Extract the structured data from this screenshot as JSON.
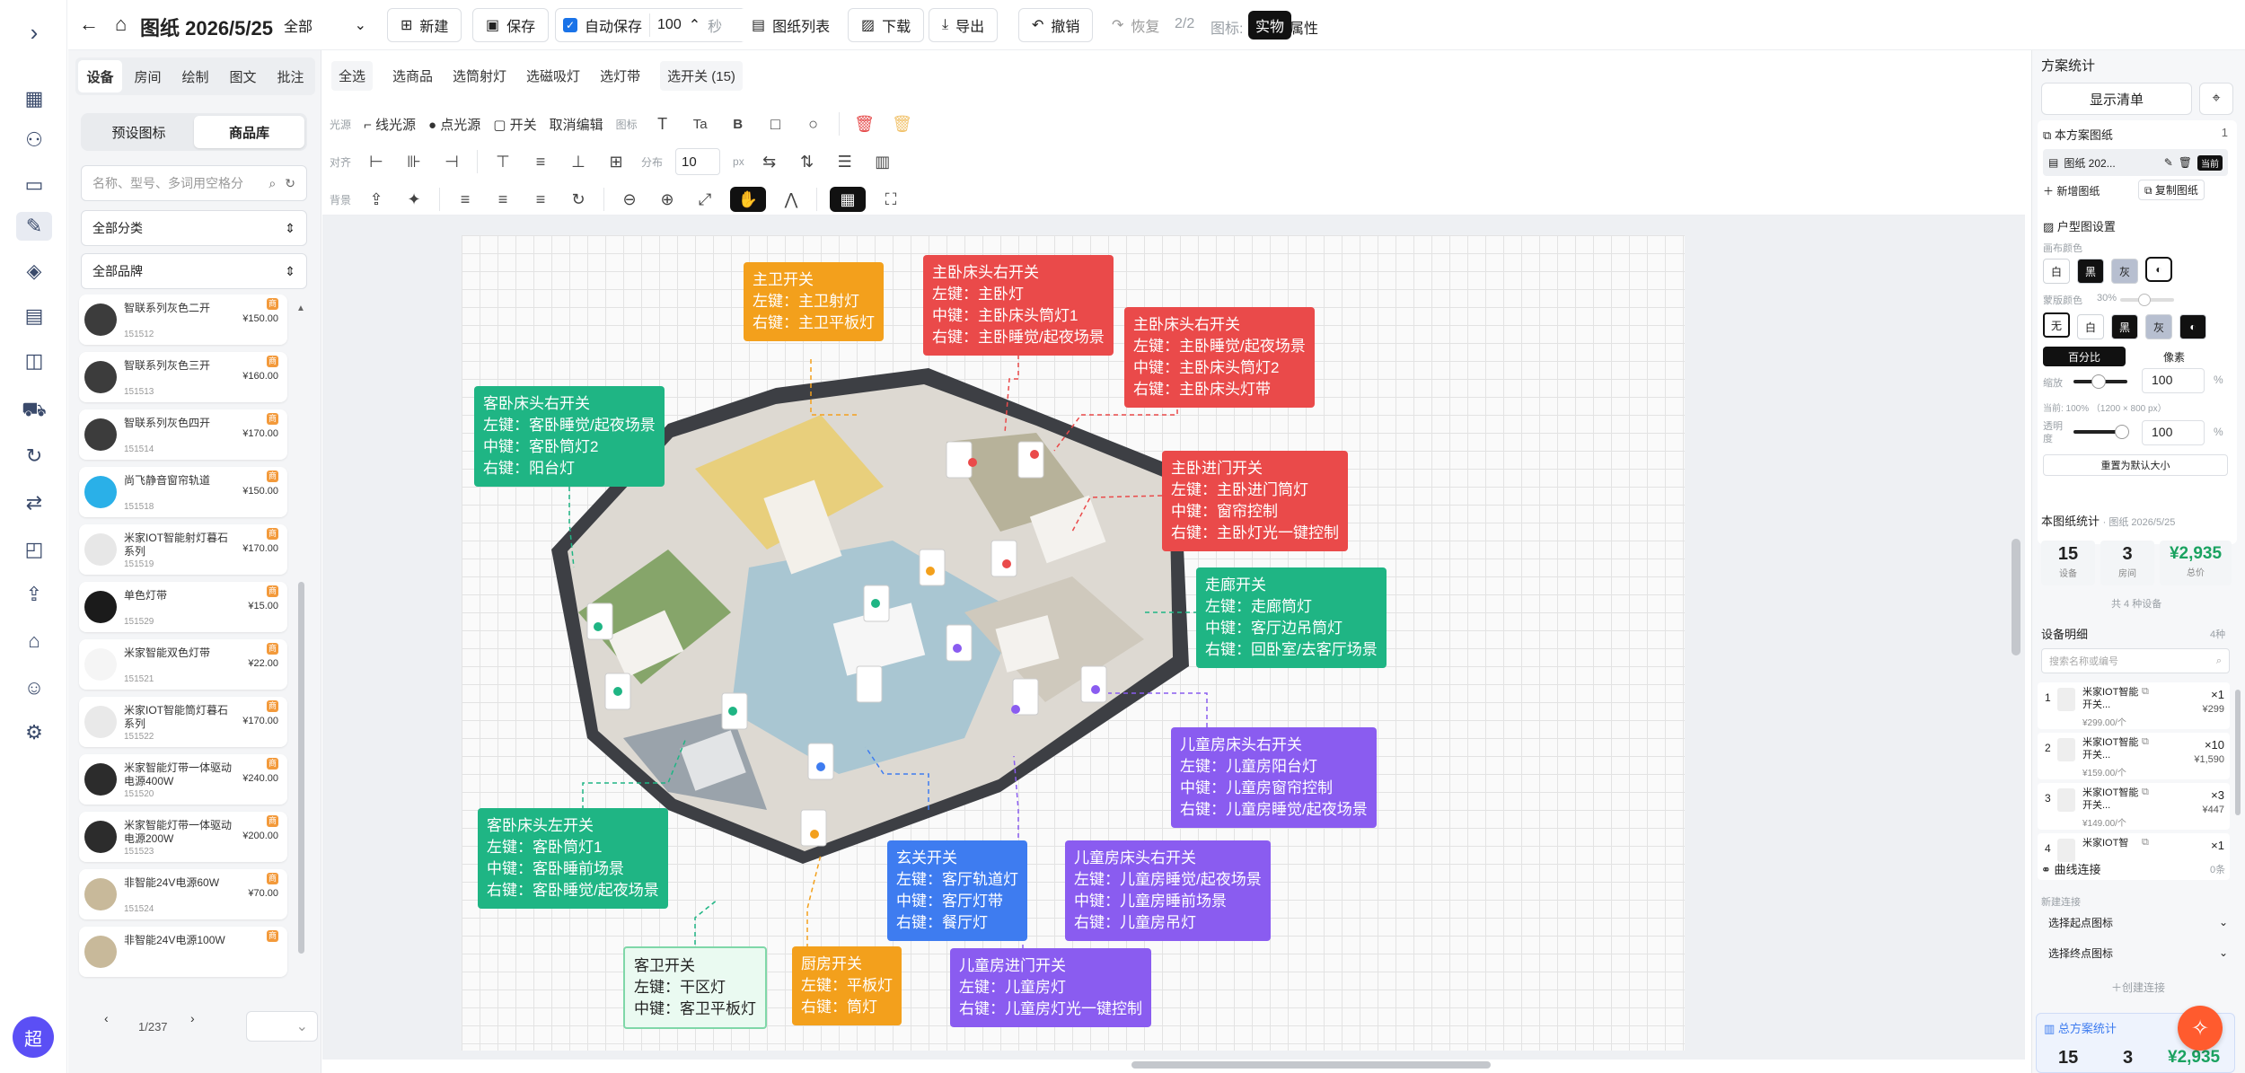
{
  "rail": {
    "expand": "›",
    "icons": [
      "layout-icon",
      "users-icon",
      "folder-icon",
      "design-icon",
      "box-icon",
      "ledger-icon",
      "bag-icon",
      "truck-icon",
      "refresh-icon",
      "swap-icon",
      "cart-icon",
      "upload-icon",
      "store-icon",
      "robot-icon",
      "settings-icon"
    ],
    "avatar": "超"
  },
  "header": {
    "title": "图纸 2026/5/25",
    "scope": "全部",
    "new": "新建",
    "save": "保存",
    "autosave": "自动保存",
    "autosave_value": "100",
    "seconds": "秒",
    "list": "图纸列表",
    "download": "下载",
    "export": "导出",
    "undo": "撤销",
    "redo": "恢复",
    "page": "2/2",
    "icon_label": "图标:",
    "mode_real": "实物",
    "mode_attr": "属性"
  },
  "left": {
    "tabs": [
      "设备",
      "房间",
      "绘制",
      "图文",
      "批注"
    ],
    "seg": [
      "预设图标",
      "商品库"
    ],
    "search_placeholder": "名称、型号、多词用空格分",
    "category": "全部分类",
    "brand": "全部品牌",
    "products": [
      {
        "name": "智联系列灰色二开",
        "sku": "151512",
        "price": "¥150.00",
        "tag": "商"
      },
      {
        "name": "智联系列灰色三开",
        "sku": "151513",
        "price": "¥160.00",
        "tag": "商"
      },
      {
        "name": "智联系列灰色四开",
        "sku": "151514",
        "price": "¥170.00",
        "tag": "商"
      },
      {
        "name": "尚飞静音窗帘轨道",
        "sku": "151518",
        "price": "¥150.00",
        "tag": "商"
      },
      {
        "name": "米家IOT智能射灯暮石系列",
        "sku": "151519",
        "price": "¥170.00",
        "tag": "商"
      },
      {
        "name": "单色灯带",
        "sku": "151529",
        "price": "¥15.00",
        "tag": "商"
      },
      {
        "name": "米家智能双色灯带",
        "sku": "151521",
        "price": "¥22.00",
        "tag": "商"
      },
      {
        "name": "米家IOT智能筒灯暮石系列",
        "sku": "151522",
        "price": "¥170.00",
        "tag": "商"
      },
      {
        "name": "米家智能灯带一体驱动电源400W",
        "sku": "151520",
        "price": "¥240.00",
        "tag": "商"
      },
      {
        "name": "米家智能灯带一体驱动电源200W",
        "sku": "151523",
        "price": "¥200.00",
        "tag": "商"
      },
      {
        "name": "非智能24V电源60W",
        "sku": "151524",
        "price": "¥70.00",
        "tag": "商"
      },
      {
        "name": "非智能24V电源100W",
        "sku": "",
        "price": "",
        "tag": "商"
      }
    ],
    "pager": "1/237"
  },
  "toolbar": {
    "row1": [
      "全选",
      "选商品",
      "选筒射灯",
      "选磁吸灯",
      "选灯带",
      "选开关 (15)"
    ],
    "light_label": "光源",
    "line_light": "线光源",
    "point_light": "点光源",
    "switch": "开关",
    "cancel_edit": "取消编辑",
    "icon_label": "图标",
    "text_t": "Ta",
    "bold": "B",
    "align_label": "对齐",
    "distribute": "分布",
    "dist_value": "10",
    "px": "px",
    "bg_label": "背景"
  },
  "callouts": [
    {
      "id": "c1",
      "color": "o",
      "lines": [
        "主卫开关",
        "左键：主卫射灯",
        "右键：主卫平板灯"
      ]
    },
    {
      "id": "c2",
      "color": "r",
      "lines": [
        "主卧床头右开关",
        "左键：主卧灯",
        "中键：主卧床头筒灯1",
        "右键：主卧睡觉/起夜场景"
      ]
    },
    {
      "id": "c3",
      "color": "r",
      "lines": [
        "主卧床头右开关",
        "左键：主卧睡觉/起夜场景",
        "中键：主卧床头筒灯2",
        "右键：主卧床头灯带"
      ]
    },
    {
      "id": "c4",
      "color": "g",
      "lines": [
        "客卧床头右开关",
        "左键：客卧睡觉/起夜场景",
        "中键：客卧筒灯2",
        "右键：阳台灯"
      ]
    },
    {
      "id": "c5",
      "color": "r",
      "lines": [
        "主卧进门开关",
        "左键：主卧进门筒灯",
        "中键：窗帘控制",
        "右键：主卧灯光一键控制"
      ]
    },
    {
      "id": "c6",
      "color": "g",
      "lines": [
        "走廊开关",
        "左键：走廊筒灯",
        "中键：客厅边吊筒灯",
        "右键：回卧室/去客厅场景"
      ]
    },
    {
      "id": "c7",
      "color": "p",
      "lines": [
        "儿童房床头右开关",
        "左键：儿童房阳台灯",
        "中键：儿童房窗帘控制",
        "右键：儿童房睡觉/起夜场景"
      ]
    },
    {
      "id": "c8",
      "color": "g",
      "lines": [
        "客卧床头左开关",
        "左键：客卧筒灯1",
        "中键：客卧睡前场景",
        "右键：客卧睡觉/起夜场景"
      ]
    },
    {
      "id": "c9",
      "color": "b",
      "lines": [
        "玄关开关",
        "左键：客厅轨道灯",
        "中键：客厅灯带",
        "右键：餐厅灯"
      ]
    },
    {
      "id": "c10",
      "color": "p",
      "lines": [
        "儿童房床头右开关",
        "左键：儿童房睡觉/起夜场景",
        "中键：儿童房睡前场景",
        "右键：儿童房吊灯"
      ]
    },
    {
      "id": "c11",
      "color": "w",
      "lines": [
        "客卫开关",
        "左键：干区灯",
        "中键：客卫平板灯"
      ]
    },
    {
      "id": "c12",
      "color": "o",
      "lines": [
        "厨房开关",
        "左键：平板灯",
        "右键：筒灯"
      ]
    },
    {
      "id": "c13",
      "color": "p",
      "lines": [
        "儿童房进门开关",
        "左键：儿童房灯",
        "右键：儿童房灯光一键控制"
      ]
    }
  ],
  "right": {
    "title": "方案统计",
    "show_list": "显示清单",
    "plans_label": "本方案图纸",
    "plans_count": "1",
    "plan_name": "图纸 202...",
    "current": "当前",
    "new_plan": "新增图纸",
    "copy_plan": "复制图纸",
    "floor_settings": "户型图设置",
    "canvas_color": "画布颜色",
    "canvas_colors": [
      "白",
      "黑",
      "灰"
    ],
    "mask_color": "蒙版颜色",
    "mask_pct": "30%",
    "mask_colors": [
      "无",
      "白",
      "黑",
      "灰"
    ],
    "percent": "百分比",
    "pixel": "像素",
    "zoom_label": "缩放",
    "zoom": "100",
    "pct": "%",
    "current_info": "当前: 100% （1200 × 800 px）",
    "opacity_label": "透明度",
    "opacity": "100",
    "reset": "重置为默认大小",
    "stats_title": "本图纸统计",
    "stats_sub": "· 图纸 2026/5/25",
    "devices": "15",
    "devices_label": "设备",
    "rooms": "3",
    "rooms_label": "房间",
    "total": "¥2,935",
    "total_label": "总价",
    "kinds": "共 4 种设备",
    "detail_title": "设备明细",
    "detail_count": "4种",
    "detail_placeholder": "搜索名称或编号",
    "detail_items": [
      {
        "n": "1",
        "name": "米家IOT智能开关...",
        "unit": "¥299.00/个",
        "qty": "×1",
        "amount": "¥299"
      },
      {
        "n": "2",
        "name": "米家IOT智能开关...",
        "unit": "¥159.00/个",
        "qty": "×10",
        "amount": "¥1,590"
      },
      {
        "n": "3",
        "name": "米家IOT智能开关...",
        "unit": "¥149.00/个",
        "qty": "×3",
        "amount": "¥447"
      },
      {
        "n": "4",
        "name": "米家IOT智",
        "unit": "",
        "qty": "×1",
        "amount": ""
      }
    ],
    "curve": "曲线连接",
    "curve_count": "0条",
    "new_conn": "新建连接",
    "start": "选择起点图标",
    "end": "选择终点图标",
    "create": "创建连接",
    "total_title": "总方案统计",
    "t_devices": "15",
    "t_rooms": "3",
    "t_total": "¥2,935"
  },
  "colors": {
    "orange": "#f3a01c",
    "red": "#ea4a4a",
    "green": "#1fb584",
    "blue": "#3e7cf0",
    "purple": "#8a5cf0",
    "accent": "#1a1a1a",
    "fab": "#ff5b2e",
    "avatar": "#5b4ff5"
  }
}
